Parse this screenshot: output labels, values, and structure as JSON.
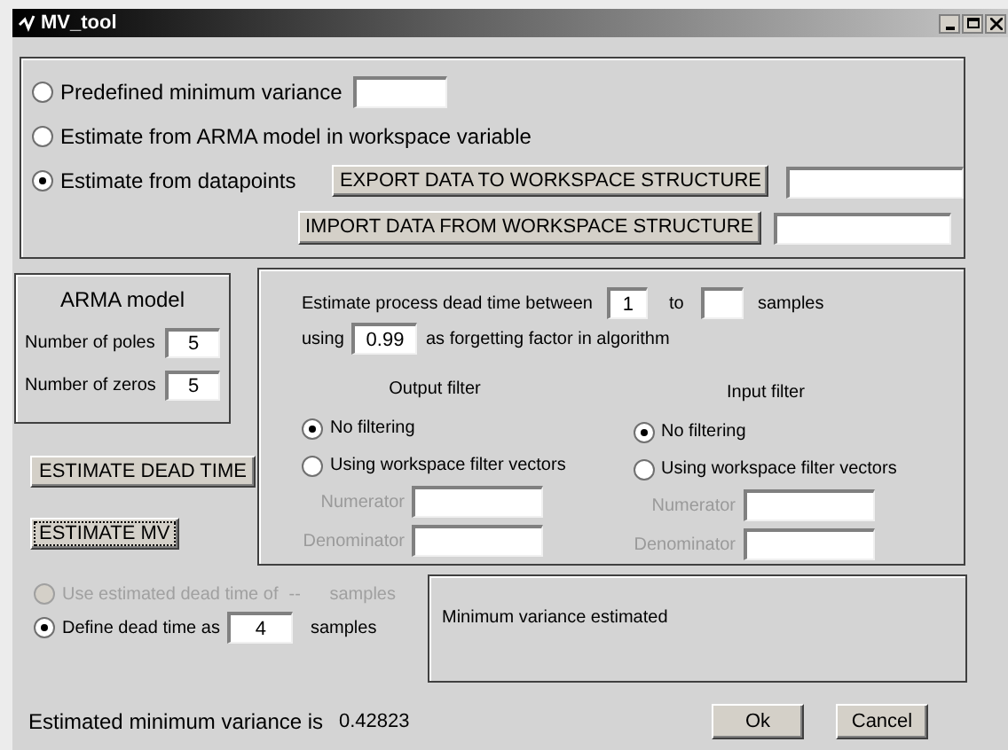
{
  "window": {
    "title": "MV_tool"
  },
  "source": {
    "options": [
      {
        "label": "Predefined minimum variance",
        "selected": false
      },
      {
        "label": "Estimate from ARMA model in workspace variable",
        "selected": false
      },
      {
        "label": "Estimate from datapoints",
        "selected": true
      }
    ],
    "export_button": "EXPORT DATA TO WORKSPACE STRUCTURE",
    "import_button": "IMPORT DATA FROM WORKSPACE STRUCTURE"
  },
  "arma_model": {
    "title": "ARMA model",
    "fields": [
      {
        "label": "Number of poles",
        "value": "5"
      },
      {
        "label": "Number of zeros",
        "value": "5"
      }
    ]
  },
  "buttons": [
    {
      "label": "ESTIMATE DEAD TIME",
      "focused": false
    },
    {
      "label": "ESTIMATE MV",
      "focused": true
    }
  ],
  "dead_time_estimation": {
    "between_label": "Estimate process dead time between",
    "from": "1",
    "to_label": "to",
    "samples_label": "samples",
    "using_label": "using",
    "forgetting_factor": "0.99",
    "forgetting_label": "as forgetting factor in algorithm"
  },
  "filters": [
    {
      "title": "Output filter",
      "options": [
        {
          "label": "No filtering",
          "selected": true
        },
        {
          "label": "Using workspace filter vectors",
          "selected": false
        }
      ],
      "vectors": [
        {
          "label": "Numerator",
          "disabled": true
        },
        {
          "label": "Denominator",
          "disabled": true
        }
      ]
    },
    {
      "title": "Input filter",
      "options": [
        {
          "label": "No filtering",
          "selected": true
        },
        {
          "label": "Using workspace filter vectors",
          "selected": false
        }
      ],
      "vectors": [
        {
          "label": "Numerator",
          "disabled": true
        },
        {
          "label": "Denominator",
          "disabled": true
        }
      ]
    }
  ],
  "dead_time_choice": [
    {
      "kind": "text",
      "label": "Use estimated dead time of",
      "selected": false,
      "disabled": true,
      "value": "--",
      "unit": "samples"
    },
    {
      "kind": "field",
      "label": "Define dead time as",
      "selected": true,
      "disabled": false,
      "value": "4",
      "unit": "samples"
    }
  ],
  "message": "Minimum variance estimated",
  "result": {
    "label": "Estimated minimum variance is",
    "value": "0.42823"
  },
  "actions": [
    "Ok",
    "Cancel"
  ]
}
